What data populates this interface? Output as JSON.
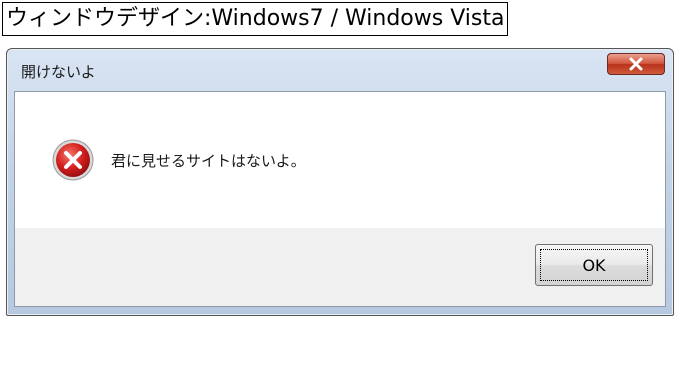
{
  "caption": {
    "text": "ウィンドウデザイン:Windows7 / Windows Vista"
  },
  "dialog": {
    "title": "開けないよ",
    "close_icon": "close-x-icon",
    "message": "君に見せるサイトはないよ。",
    "icon": "error-icon",
    "ok_label": "OK"
  },
  "colors": {
    "close_button": "#c8452c",
    "error_red": "#d42020",
    "footer_bg": "#f0f0f0"
  }
}
